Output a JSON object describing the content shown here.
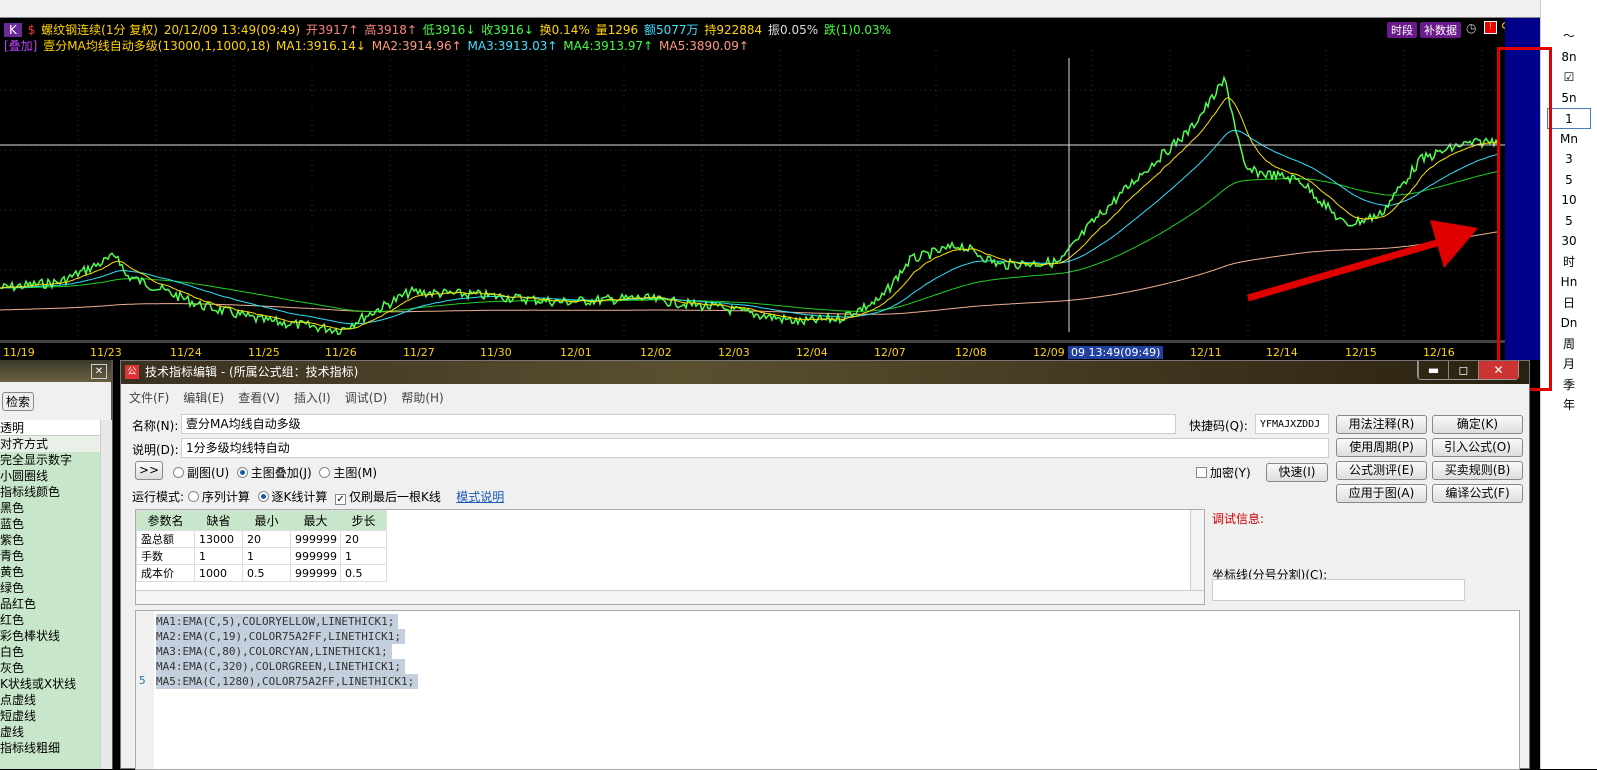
{
  "header": {
    "badge": "K",
    "s_icon": "$",
    "title": "螺纹钢连续(1分 复权)",
    "datetime": "20/12/09 13:49(09:49)",
    "open": "开3917↑",
    "high": "高3918↑",
    "low": "低3916↓",
    "close": "收3916↓",
    "turnover": "换0.14%",
    "volume": "量1296",
    "amount": "额5077万",
    "hold": "持922884",
    "amplitude": "振0.05%",
    "change": "跌(1)0.03%"
  },
  "indicator": {
    "tag": "[叠加]",
    "name": "壹分MA均线自动多级(13000,1,1000,18)",
    "ma1": "MA1:3916.14↓",
    "ma2": "MA2:3914.96↑",
    "ma3": "MA3:3913.03↑",
    "ma4": "MA4:3913.97↑",
    "ma5": "MA5:3890.09↑"
  },
  "chart_buttons": {
    "period": "时段",
    "fill_data": "补数据"
  },
  "dates": [
    "11/19",
    "11/23",
    "11/24",
    "11/25",
    "11/26",
    "11/27",
    "11/30",
    "12/01",
    "12/02",
    "12/03",
    "12/04",
    "12/07",
    "12/08",
    "12/09",
    "12/11",
    "12/14",
    "12/15",
    "12/16"
  ],
  "cursor_label": "09 13:49(09:49)",
  "right_toolbar": [
    "〜",
    "8n",
    "☑",
    "5n",
    "1",
    "Mn",
    "3",
    "5",
    "10",
    "5",
    "30",
    "时",
    "Hn",
    "日",
    "Dn",
    "周",
    "月",
    "季",
    "年"
  ],
  "left_panel": {
    "search": "检索",
    "items": [
      "透明",
      "对齐方式",
      "完全显示数字",
      "小圆圈线",
      "指标线颜色",
      "黑色",
      "蓝色",
      "紫色",
      "青色",
      "黄色",
      "绿色",
      "品红色",
      "红色",
      "彩色棒状线",
      "白色",
      "灰色",
      "K状线或X状线",
      "点虚线",
      "短虚线",
      "虚线",
      "指标线粗细"
    ]
  },
  "dialog": {
    "title": "技术指标编辑 - (所属公式组：技术指标)",
    "menu": [
      "文件(F)",
      "编辑(E)",
      "查看(V)",
      "插入(I)",
      "调试(D)",
      "帮助(H)"
    ],
    "name_label": "名称(N):",
    "name_value": "壹分MA均线自动多级",
    "desc_label": "说明(D):",
    "desc_value": "1分多级均线特自动",
    "shortcut_label": "快捷码(Q):",
    "shortcut_value": "YFMAJXZDDJ",
    "expand": ">>",
    "sub_chart": "副图(U)",
    "overlay": "主图叠加(J)",
    "main_chart": "主图(M)",
    "encrypt": "加密(Y)",
    "fast": "快速(I)",
    "run_mode": "运行模式:",
    "seq_calc": "序列计算",
    "bar_calc": "逐K线计算",
    "last_bar": "仅刷最后一根K线",
    "mode_help": "模式说明",
    "buttons": [
      "用法注释(R)",
      "确定(K)",
      "使用周期(P)",
      "引入公式(O)",
      "公式测评(E)",
      "买卖规则(B)",
      "应用于图(A)",
      "编译公式(F)"
    ],
    "debug_label": "调试信息:",
    "axis_label": "坐标线(分号分割)(C):",
    "params_headers": [
      "参数名",
      "缺省",
      "最小",
      "最大",
      "步长"
    ],
    "params": [
      [
        "盈总额",
        "13000",
        "20",
        "999999",
        "20"
      ],
      [
        "手数",
        "1",
        "1",
        "999999",
        "1"
      ],
      [
        "成本价",
        "1000",
        "0.5",
        "999999",
        "0.5"
      ]
    ],
    "code": [
      "MA1:EMA(C,5),COLORYELLOW,LINETHICK1;",
      "MA2:EMA(C,19),COLOR75A2FF,LINETHICK1;",
      "MA3:EMA(C,80),COLORCYAN,LINETHICK1;",
      "MA4:EMA(C,320),COLORGREEN,LINETHICK1;",
      "MA5:EMA(C,1280),COLOR75A2FF,LINETHICK1;"
    ],
    "line_number": "5"
  },
  "window_controls": {
    "minimize": "▬",
    "maximize": "◻",
    "close": "✕"
  }
}
